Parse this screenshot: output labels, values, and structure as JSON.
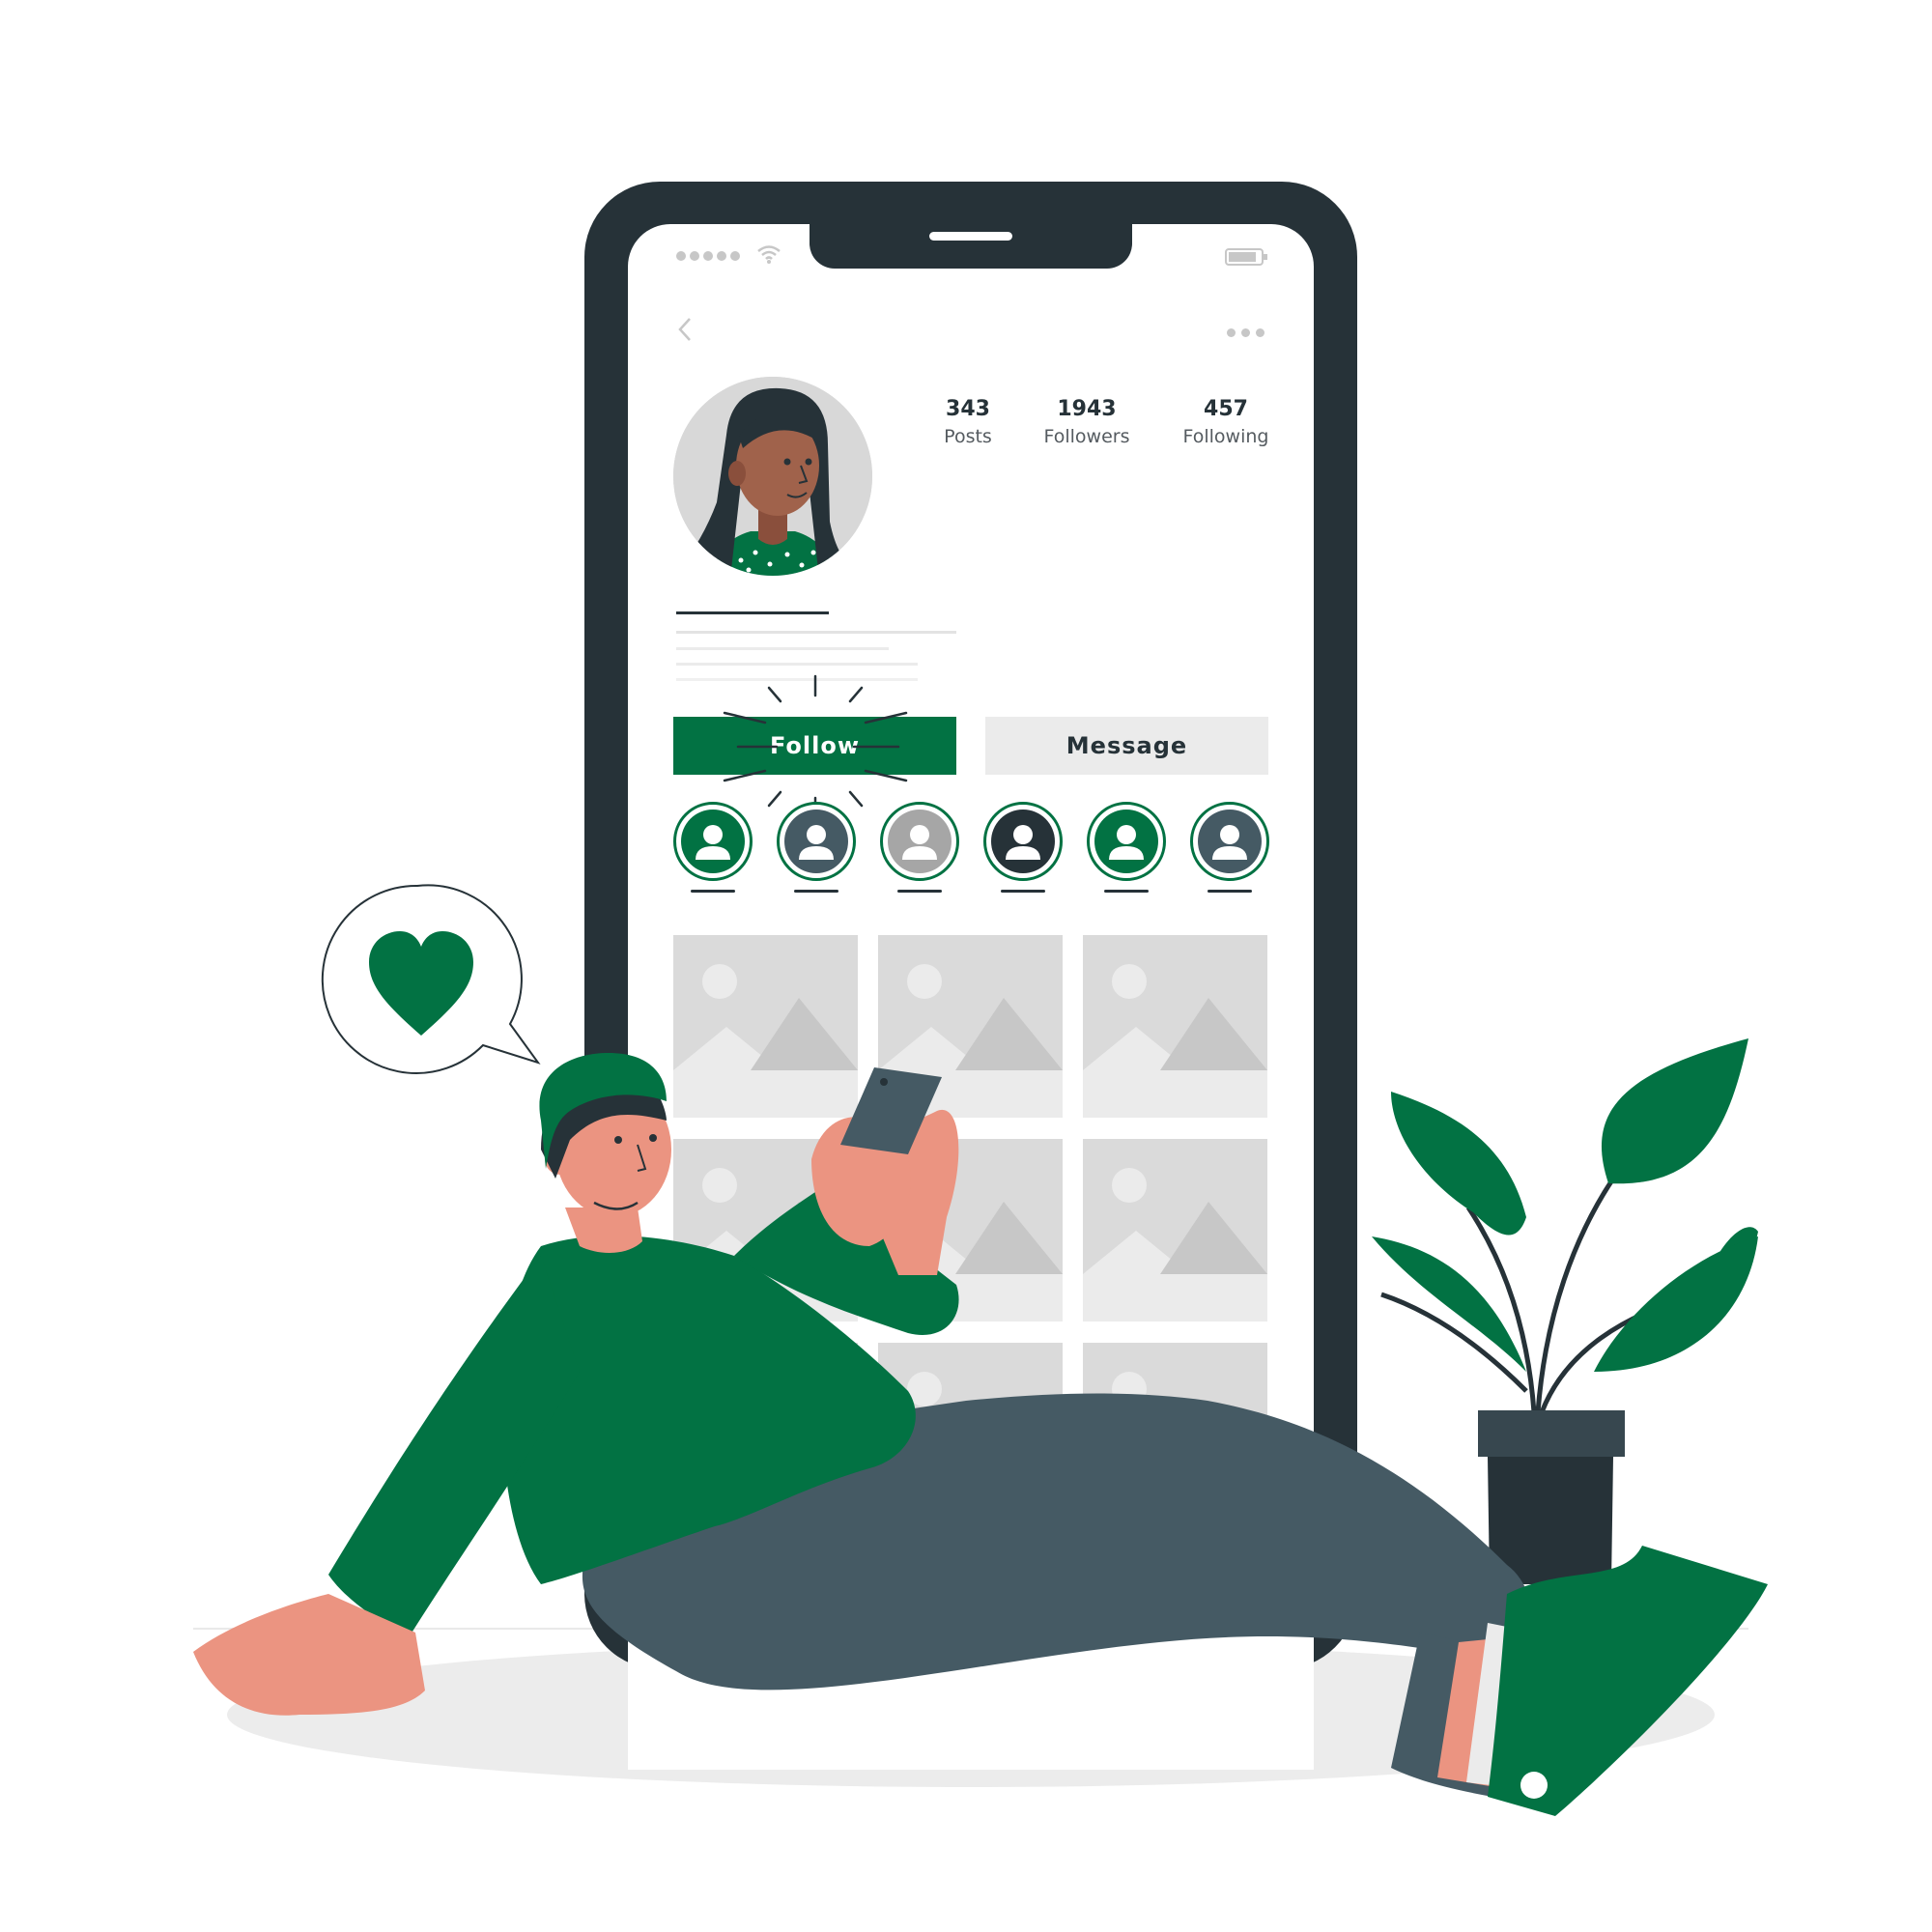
{
  "profile": {
    "stats": [
      {
        "value": "343",
        "label": "Posts"
      },
      {
        "value": "1943",
        "label": "Followers"
      },
      {
        "value": "457",
        "label": "Following"
      }
    ],
    "follow_label": "Follow",
    "message_label": "Message",
    "highlights": [
      {
        "icon": "user-icon",
        "color": "#027243"
      },
      {
        "icon": "user-icon",
        "color": "#455a64"
      },
      {
        "icon": "user-icon",
        "color": "#a6a6a6"
      },
      {
        "icon": "user-icon",
        "color": "#263238"
      },
      {
        "icon": "user-icon",
        "color": "#027243"
      },
      {
        "icon": "user-icon",
        "color": "#455a64"
      }
    ],
    "posts": [
      {
        "icon": "image-placeholder-icon"
      },
      {
        "icon": "image-placeholder-icon"
      },
      {
        "icon": "image-placeholder-icon"
      },
      {
        "icon": "image-placeholder-icon"
      },
      {
        "icon": "image-placeholder-icon"
      },
      {
        "icon": "image-placeholder-icon"
      },
      {
        "icon": "image-placeholder-icon"
      },
      {
        "icon": "image-placeholder-icon"
      },
      {
        "icon": "image-placeholder-icon"
      }
    ]
  },
  "status_bar": {
    "icons": [
      "signal-icon",
      "wifi-icon",
      "battery-icon"
    ]
  },
  "nav": {
    "icons": [
      "back-icon",
      "more-icon"
    ]
  },
  "bubble": {
    "icon": "heart-icon"
  },
  "colors": {
    "accent": "#027243",
    "phone_frame": "#263238",
    "pants": "#455a64",
    "skin": "#eb9481",
    "placeholder": "#ebebeb"
  }
}
